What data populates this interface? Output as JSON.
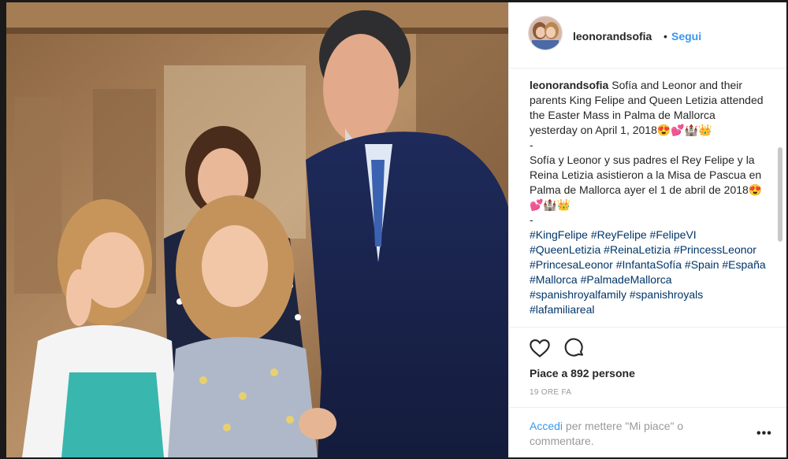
{
  "header": {
    "username": "leonorandsofia",
    "separator": "•",
    "follow_label": "Segui"
  },
  "caption": {
    "username": "leonorandsofia",
    "text_en": "Sofía and Leonor and their parents King Felipe and Queen Letizia attended the Easter Mass in Palma de Mallorca yesterday on April 1, 2018😍💕🏰👑",
    "dash1": "-",
    "text_es": "Sofía y Leonor y sus padres el Rey Felipe y la Reina Letizia asistieron a la Misa de Pascua en Palma de Mallorca ayer el 1 de abril de 2018😍💕🏰👑",
    "dash2": "-",
    "hashtags": "#KingFelipe #ReyFelipe #FelipeVI #QueenLetizia #ReinaLetizia #PrincessLeonor #PrincesaLeonor #InfantaSofía #Spain #España #Mallorca #PalmadeMallorca #spanishroyalfamily #spanishroyals #lafamiliareal"
  },
  "actions": {
    "like_icon": "heart-icon",
    "comment_icon": "comment-icon"
  },
  "likes_label": "Piace a 892 persone",
  "timestamp": "19 ORE FA",
  "login": {
    "link": "Accedi",
    "text": " per mettere \"Mi piace\" o commentare."
  },
  "more_label": "•••",
  "colors": {
    "link_blue": "#3897f0",
    "hashtag_blue": "#003569",
    "text": "#262626",
    "muted": "#999999"
  }
}
